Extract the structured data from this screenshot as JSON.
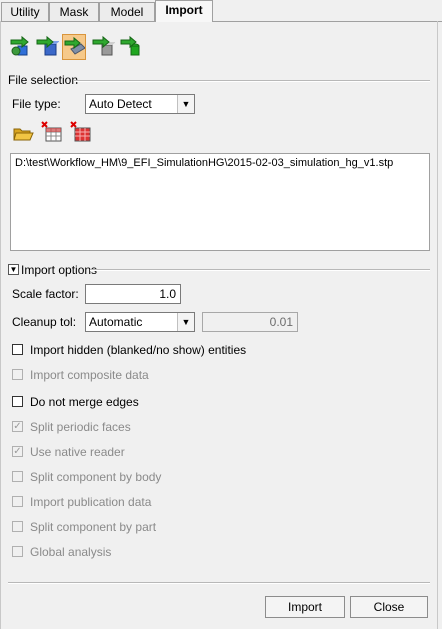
{
  "tabs": [
    {
      "label": "Utility"
    },
    {
      "label": "Mask"
    },
    {
      "label": "Model"
    },
    {
      "label": "Import"
    }
  ],
  "toolbar": {
    "icons": [
      "import-model-icon",
      "import-geometry-icon",
      "import-solver-deck-icon",
      "import-fe-overlay-icon",
      "import-connectors-icon"
    ]
  },
  "file_selection": {
    "title": "File selection",
    "file_type_label": "File type:",
    "file_type_value": "Auto Detect",
    "file_icons": [
      "open-folder-icon",
      "remove-selected-icon",
      "remove-all-icon"
    ],
    "path": "D:\\test\\Workflow_HM\\9_EFI_SimulationHG\\2015-02-03_simulation_hg_v1.stp"
  },
  "import_options": {
    "title": "Import options",
    "scale_factor_label": "Scale factor:",
    "scale_factor_value": "1.0",
    "cleanup_label": "Cleanup tol:",
    "cleanup_value": "Automatic",
    "cleanup_tol_value": "0.01",
    "options": [
      {
        "label": "Import hidden (blanked/no show) entities",
        "checked": false,
        "enabled": true
      },
      {
        "label": "Import composite data",
        "checked": false,
        "enabled": false
      },
      {
        "label": "Do not merge edges",
        "checked": false,
        "enabled": true
      },
      {
        "label": "Split periodic faces",
        "checked": true,
        "enabled": false
      },
      {
        "label": "Use native reader",
        "checked": true,
        "enabled": false
      },
      {
        "label": "Split component by body",
        "checked": false,
        "enabled": false
      },
      {
        "label": "Import publication data",
        "checked": false,
        "enabled": false
      },
      {
        "label": "Split component by part",
        "checked": false,
        "enabled": false
      },
      {
        "label": "Global analysis",
        "checked": false,
        "enabled": false
      }
    ]
  },
  "buttons": {
    "import": "Import",
    "close": "Close"
  }
}
